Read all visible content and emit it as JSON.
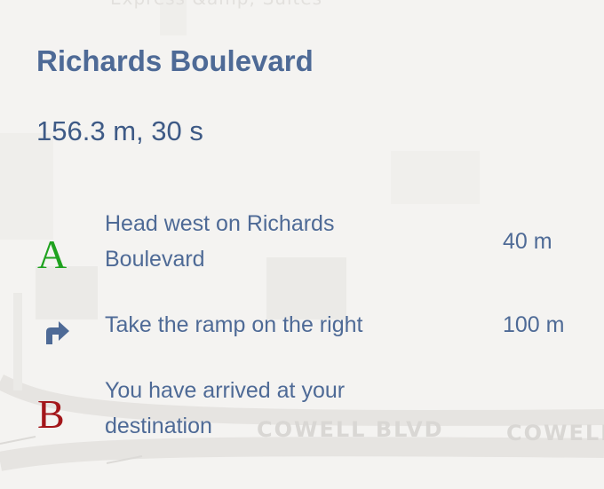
{
  "map": {
    "top_label": "Express &amp; Suites",
    "street_labels": [
      "COWELL BLVD",
      "COWELL"
    ]
  },
  "route": {
    "title": "Richards Boulevard",
    "summary": "156.3 m, 30 s"
  },
  "steps": [
    {
      "icon": "A",
      "icon_name": "start-marker-icon",
      "text": "Head west on Richards Boulevard",
      "distance": "40 m"
    },
    {
      "icon": "turn-right",
      "icon_name": "turn-right-icon",
      "text": "Take the ramp on the right",
      "distance": "100 m"
    },
    {
      "icon": "B",
      "icon_name": "destination-marker-icon",
      "text": "You have arrived at your destination",
      "distance": ""
    }
  ],
  "colors": {
    "title": "#4e6a96",
    "start_marker": "#1fa21f",
    "end_marker": "#a3161a",
    "turn_icon": "#4e6a96"
  }
}
